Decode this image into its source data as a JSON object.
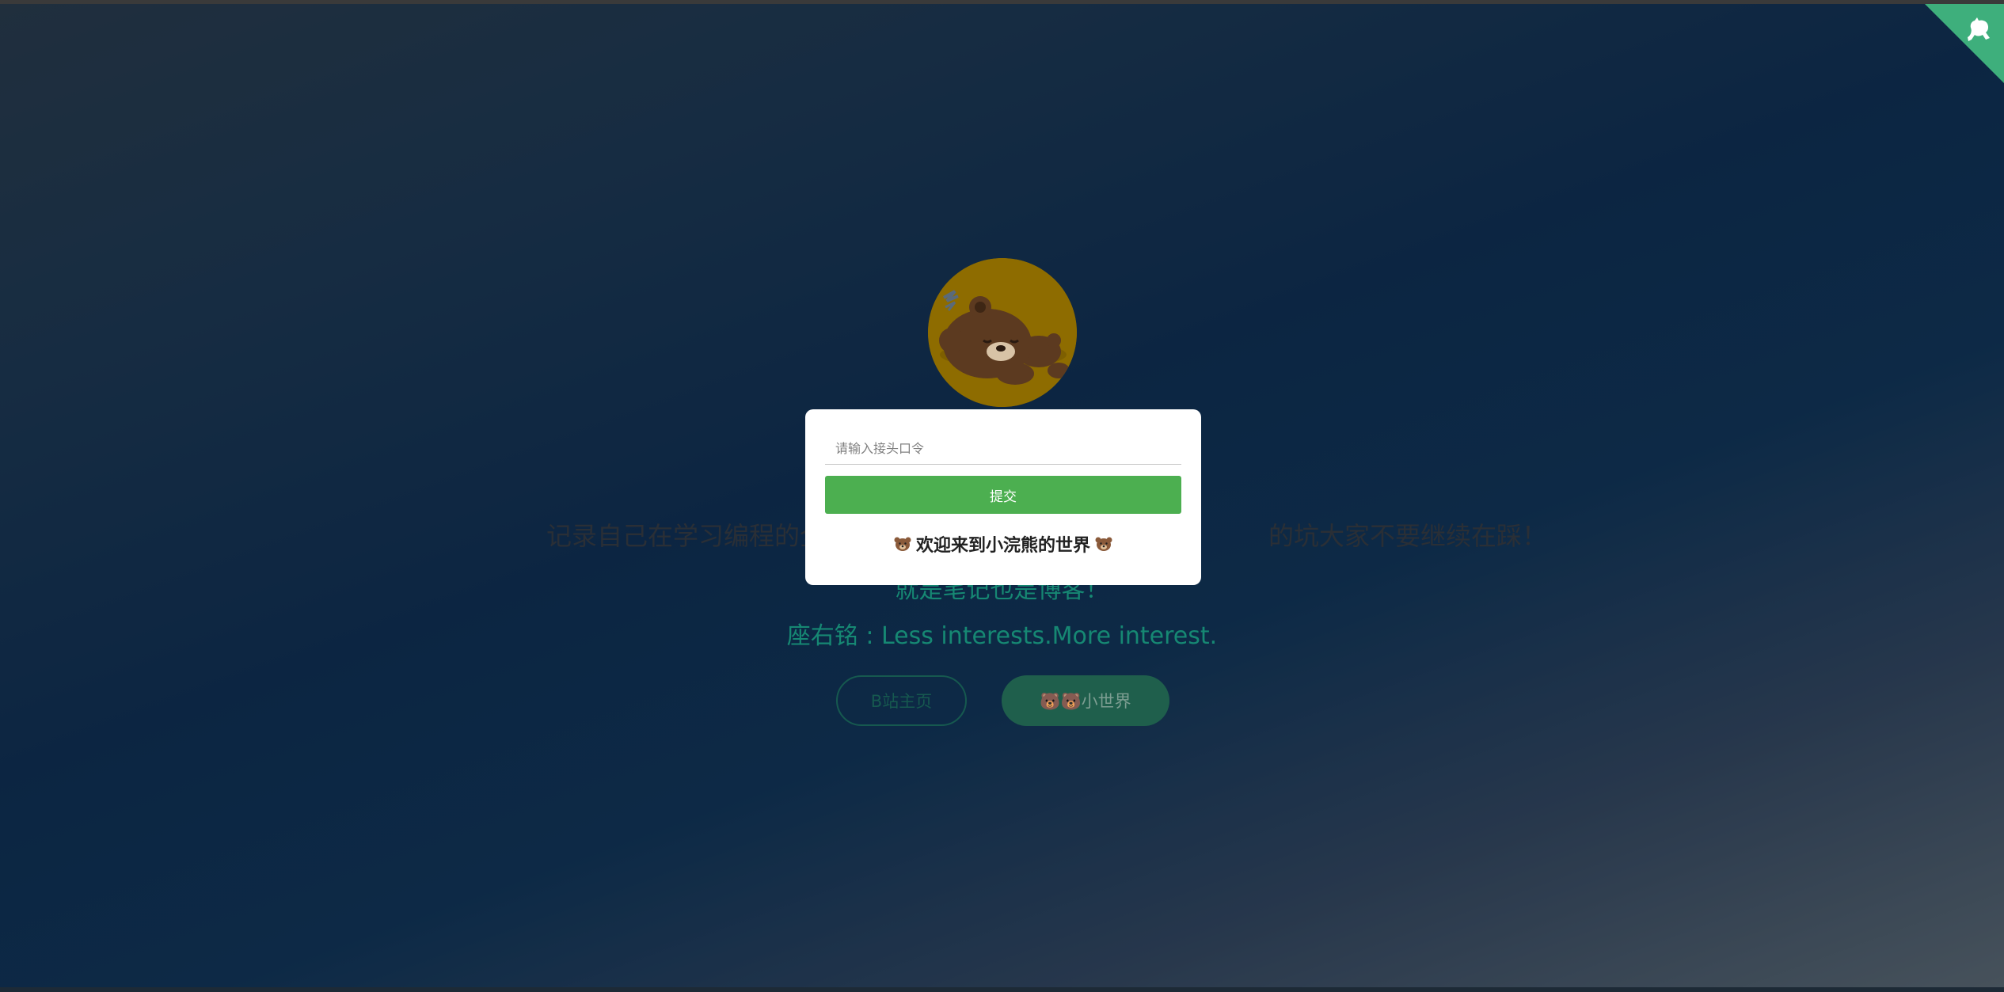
{
  "hero": {
    "description_visible": "记录自己在学习编程的全",
    "description_hidden_tail": "的坑大家不要继续在踩！",
    "subtitle": "就是笔记也是博客！",
    "motto": "座右铭 : Less interests.More interest."
  },
  "buttons": {
    "bilibili_label": "B站主页",
    "world_label": "🐻🐻小世界"
  },
  "modal": {
    "placeholder": "请输入接头口令",
    "submit_label": "提交",
    "welcome_text": "欢迎来到小浣熊的世界"
  },
  "colors": {
    "accent_green": "#3eaf7c",
    "submit_green": "#4caf50",
    "motto_teal": "#168873",
    "avatar_gold": "#8e6c00"
  },
  "icons": {
    "corner": "github-octocat-icon",
    "avatar": "sleeping-bear-avatar",
    "emoji": "bear-face-icon"
  }
}
